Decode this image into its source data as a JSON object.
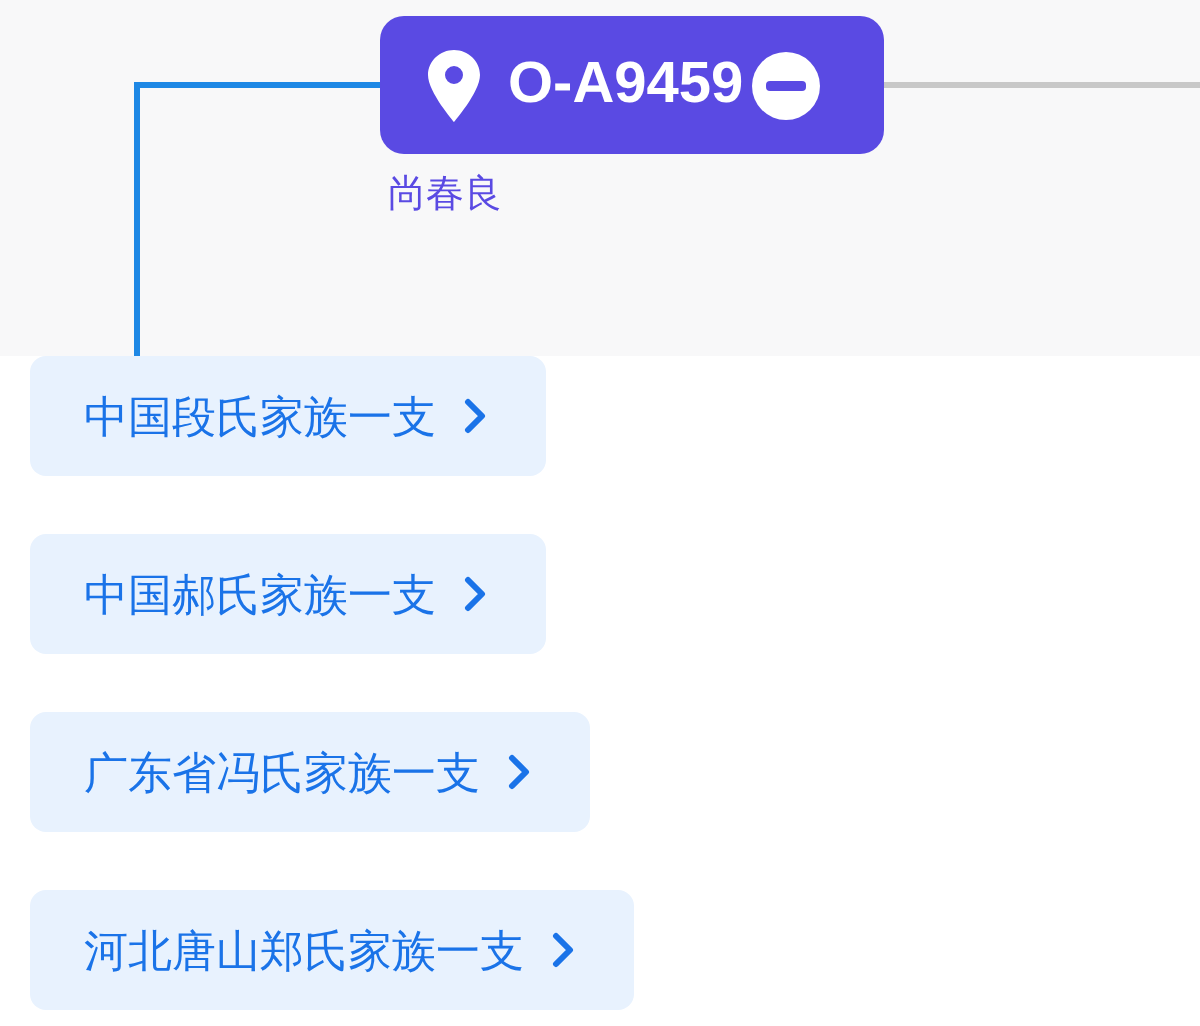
{
  "node": {
    "code": "O-A9459",
    "name": "尚春良"
  },
  "branches": [
    {
      "label": "中国段氏家族一支"
    },
    {
      "label": "中国郝氏家族一支"
    },
    {
      "label": "广东省冯氏家族一支"
    },
    {
      "label": "河北唐山郑氏家族一支"
    }
  ]
}
